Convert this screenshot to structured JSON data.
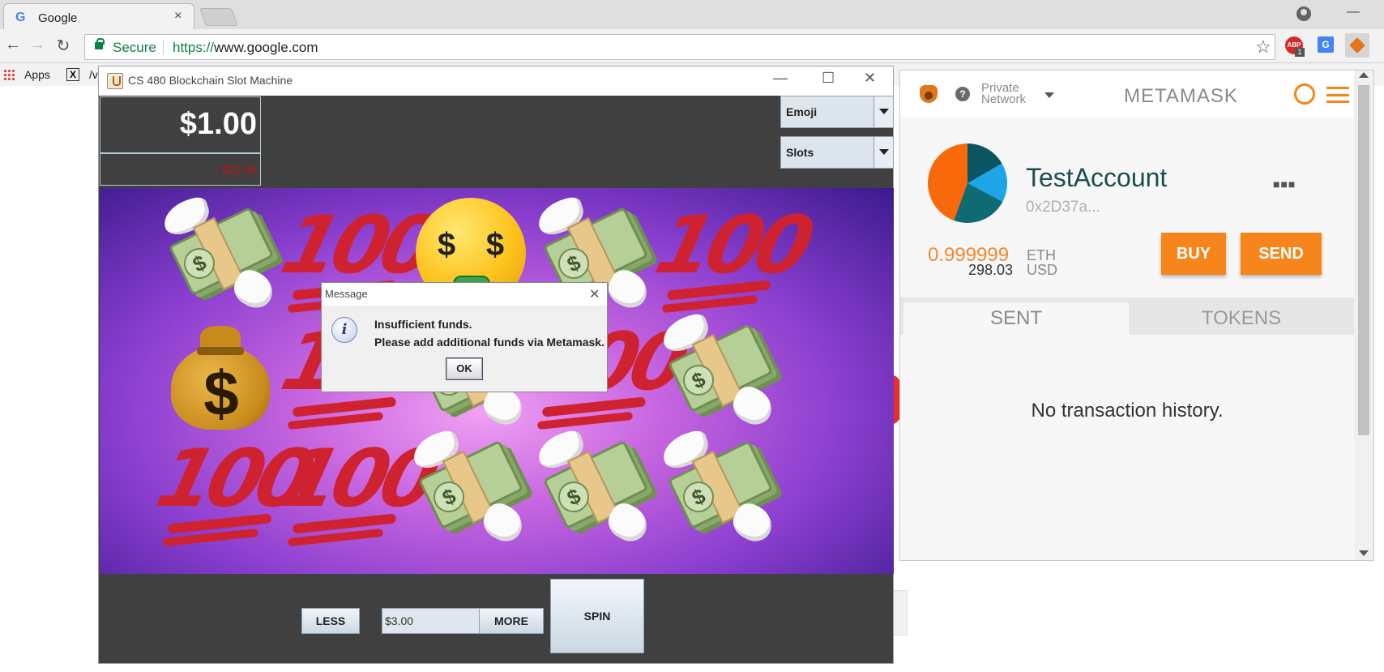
{
  "browser": {
    "tab_title": "Google",
    "tab_close": "×",
    "secure_label": "Secure",
    "url_scheme": "https://",
    "url_host": "www.google.com",
    "back": "←",
    "forward": "→",
    "reload": "↻",
    "star": "☆",
    "minimize": "—",
    "extensions": {
      "abp_label": "ABP",
      "abp_badge": "1",
      "translate_label": "G"
    },
    "bookmarks": {
      "apps_label": "Apps",
      "item_icon": "X",
      "item_label": "/v"
    }
  },
  "slot_machine": {
    "window_title": "CS 480 Blockchain Slot Machine",
    "window_controls": {
      "minimize": "—",
      "maximize": "☐",
      "close": "✕"
    },
    "balance": "$1.00",
    "delta": "- $21.00",
    "theme_select": {
      "selected": "Emoji"
    },
    "game_select": {
      "selected": "Slots"
    },
    "reels": [
      [
        "flying-money",
        "hundred",
        "money-face",
        "flying-money",
        "hundred"
      ],
      [
        "money-bag",
        "hundred",
        "flying-money",
        "hundred",
        "flying-money"
      ],
      [
        "hundred",
        "hundred",
        "flying-money",
        "flying-money",
        "flying-money"
      ]
    ],
    "symbol_text": {
      "hundred": "100",
      "dollar": "$"
    },
    "controls": {
      "less_label": "LESS",
      "bet_value": "$3.00",
      "more_label": "MORE",
      "spin_label": "SPIN"
    },
    "dialog": {
      "title": "Message",
      "close": "✕",
      "icon_glyph": "i",
      "line1": "Insufficient funds.",
      "line2": "Please add additional funds via Metamask.",
      "ok_label": "OK"
    }
  },
  "metamask": {
    "help_glyph": "?",
    "network_line1": "Private",
    "network_line2": "Network",
    "title": "METAMASK",
    "account_name": "TestAccount",
    "account_address": "0x2D37a...",
    "eth_amount": "0.999999",
    "eth_unit": "ETH",
    "usd_amount": "298.03",
    "usd_unit": "USD",
    "buy_label": "BUY",
    "send_label": "SEND",
    "tabs": {
      "sent": "SENT",
      "tokens": "TOKENS"
    },
    "empty_message": "No transaction history.",
    "accent_color": "#f6851b"
  }
}
